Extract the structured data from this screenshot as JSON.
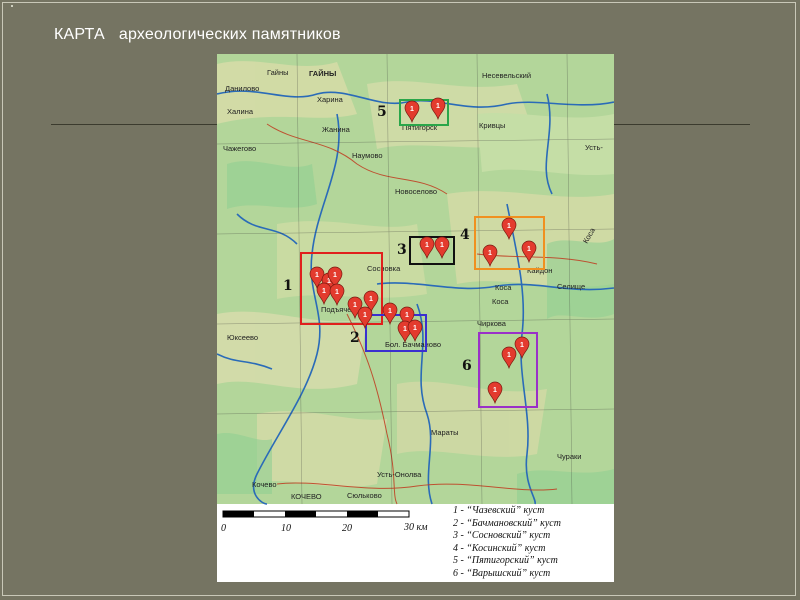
{
  "slide": {
    "title_word1": "КАРТА",
    "title_word2": "археологических памятников"
  },
  "map": {
    "place_names": {
      "gayny": "Гайны",
      "gayny2": "ГАЙНЫ",
      "danilovo": "Данилово",
      "nesel": "Несевельский",
      "kharina": "Харина",
      "zhanina": "Жанина",
      "khalina": "Халина",
      "chazhegovo": "Чажегово",
      "naumovo": "Наумово",
      "novoselovo": "Новоселово",
      "sosnovka": "Сосновка",
      "kosa": "Коса",
      "kosa2": "Коса",
      "kaydon": "Кайдон",
      "podyachev": "Подъячев",
      "yukseevo": "Юксеево",
      "chirkova": "Чиркова",
      "bol_bachmanovo": "Бол. Бачманово",
      "pyatigorsk": "Пятигорск",
      "maraty": "Мараты",
      "kochevo": "Кочево",
      "kochevo2": "КОЧЕВО",
      "ust_onolva": "Усть-Онолва",
      "syulkovo": "Сюльково",
      "churaki": "Чураки",
      "selishche": "Селище",
      "ust_kosa": "Усть-",
      "kriwy": "Кривцы",
      "kosa_river": "Коса"
    },
    "cluster_labels": [
      "1",
      "2",
      "3",
      "4",
      "5",
      "6"
    ],
    "cluster_colors": {
      "c1": "#e0201c",
      "c2": "#3a2fd0",
      "c3": "#111111",
      "c4": "#f09020",
      "c5": "#2aa64a",
      "c6": "#9a30c8"
    },
    "marker_number": "1",
    "marker_color": "#e33b2e",
    "scale": {
      "ticks": [
        "0",
        "10",
        "20",
        "30 км"
      ]
    },
    "legend": [
      "1 - “Чазевский” куст",
      "2 - “Бачмановский” куст",
      "3 - “Сосновский” куст",
      "4 - “Косинский” куст",
      "5 - “Пятигорский” куст",
      "6 - “Варышский” куст"
    ]
  }
}
